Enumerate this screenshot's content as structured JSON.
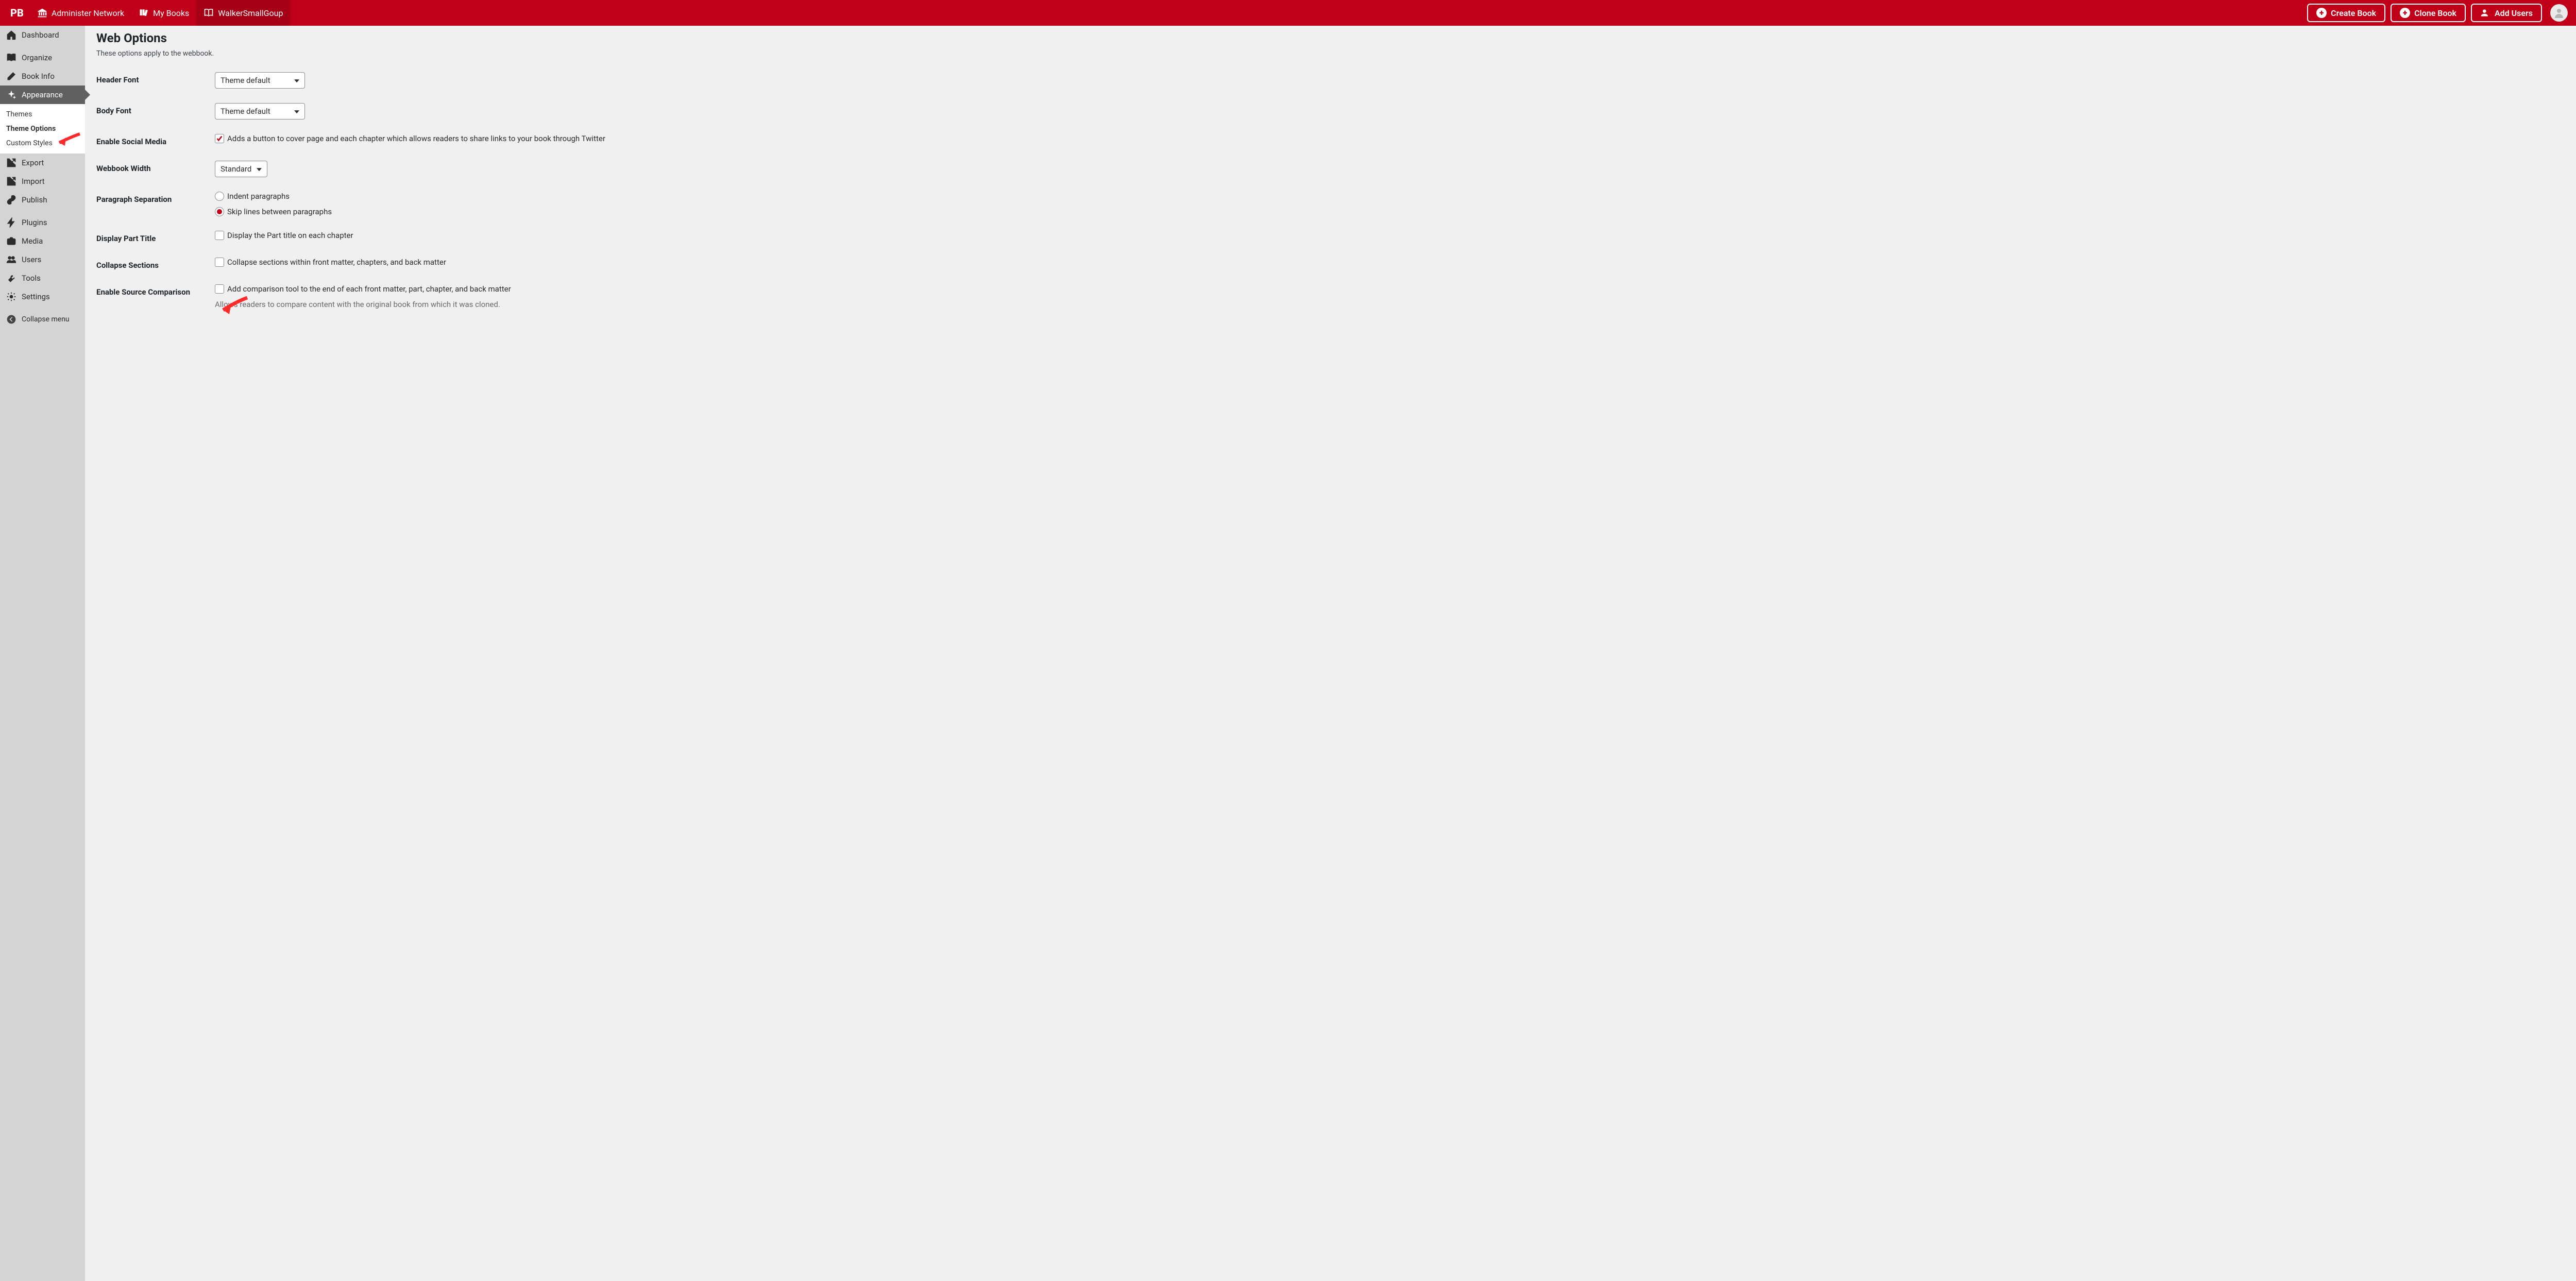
{
  "topbar": {
    "logo": "PB",
    "adminNetwork": "Administer Network",
    "myBooks": "My Books",
    "bookName": "WalkerSmallGoup",
    "createBook": "Create Book",
    "cloneBook": "Clone Book",
    "addUsers": "Add Users"
  },
  "sidebar": {
    "dashboard": "Dashboard",
    "organize": "Organize",
    "bookInfo": "Book Info",
    "appearance": "Appearance",
    "sub": {
      "themes": "Themes",
      "themeOptions": "Theme Options",
      "customStyles": "Custom Styles"
    },
    "export": "Export",
    "import": "Import",
    "publish": "Publish",
    "plugins": "Plugins",
    "media": "Media",
    "users": "Users",
    "tools": "Tools",
    "settings": "Settings",
    "collapse": "Collapse menu"
  },
  "page": {
    "title": "Web Options",
    "desc": "These options apply to the webbook.",
    "headerFont": {
      "label": "Header Font",
      "value": "Theme default"
    },
    "bodyFont": {
      "label": "Body Font",
      "value": "Theme default"
    },
    "social": {
      "label": "Enable Social Media",
      "text": "Adds a button to cover page and each chapter which allows readers to share links to your book through Twitter"
    },
    "width": {
      "label": "Webbook Width",
      "value": "Standard"
    },
    "para": {
      "label": "Paragraph Separation",
      "opt1": "Indent paragraphs",
      "opt2": "Skip lines between paragraphs"
    },
    "partTitle": {
      "label": "Display Part Title",
      "text": "Display the Part title on each chapter"
    },
    "collapseSec": {
      "label": "Collapse Sections",
      "text": "Collapse sections within front matter, chapters, and back matter"
    },
    "sourceComp": {
      "label": "Enable Source Comparison",
      "text": "Add comparison tool to the end of each front matter, part, chapter, and back matter",
      "helper": "Allows readers to compare content with the original book from which it was cloned."
    }
  }
}
